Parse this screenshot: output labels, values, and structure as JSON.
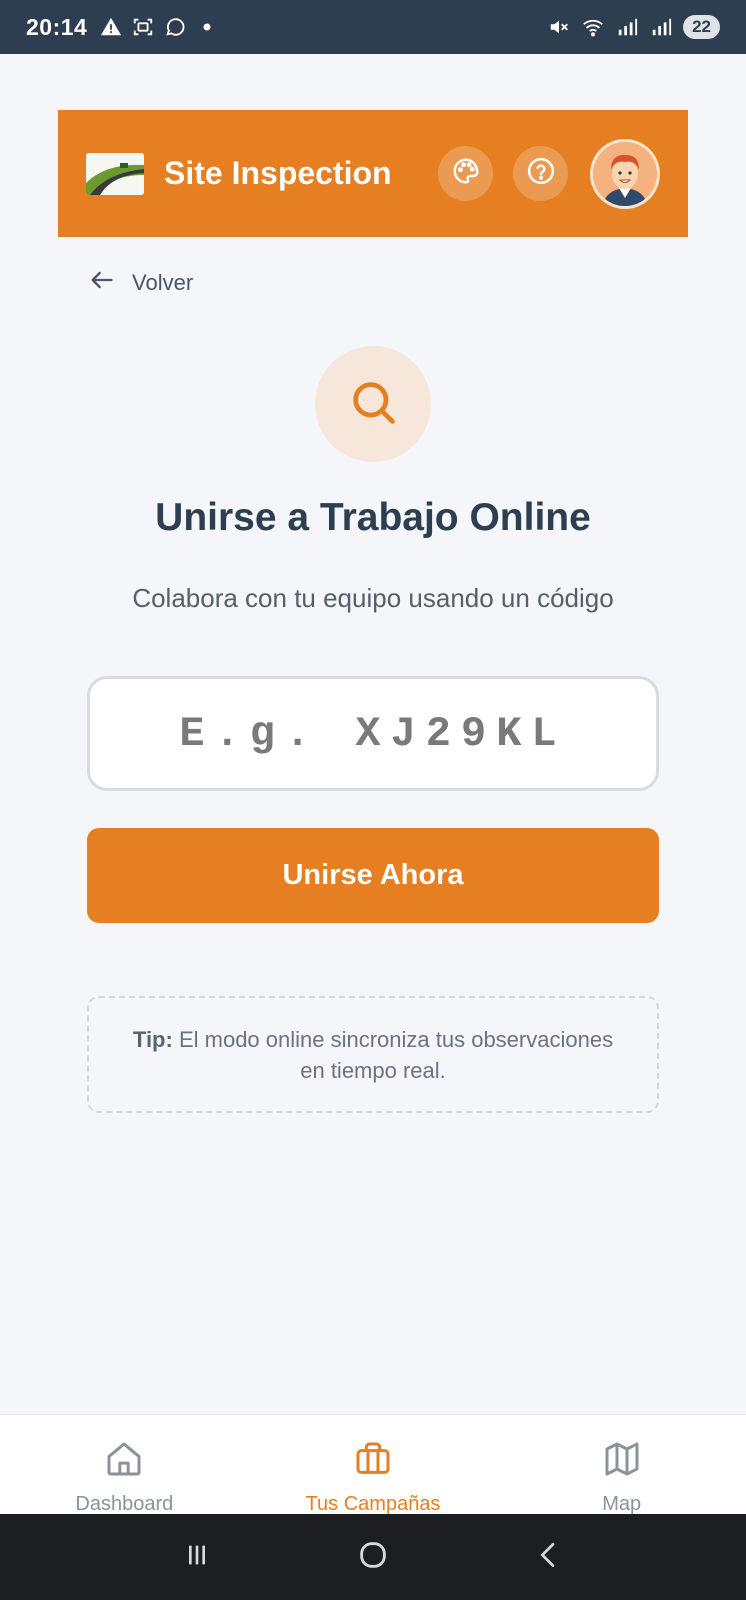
{
  "status_bar": {
    "time": "20:14",
    "battery": "22"
  },
  "header": {
    "title": "Site Inspection",
    "accent_color": "#e67e22",
    "icons": [
      "palette-icon",
      "help-icon"
    ]
  },
  "back": {
    "label": "Volver"
  },
  "main": {
    "title": "Unirse a Trabajo Online",
    "subtitle": "Colabora con tu equipo usando un código",
    "code_placeholder": "E.g. XJ29KL",
    "code_value": "",
    "join_button": "Unirse Ahora",
    "tip_label": "Tip:",
    "tip_text": "El modo online sincroniza tus observaciones en tiempo real."
  },
  "bottom_nav": {
    "items": [
      {
        "label": "Dashboard",
        "icon": "home-icon",
        "active": false
      },
      {
        "label": "Tus Campañas",
        "icon": "briefcase-icon",
        "active": true
      },
      {
        "label": "Map",
        "icon": "map-icon",
        "active": false
      }
    ]
  }
}
